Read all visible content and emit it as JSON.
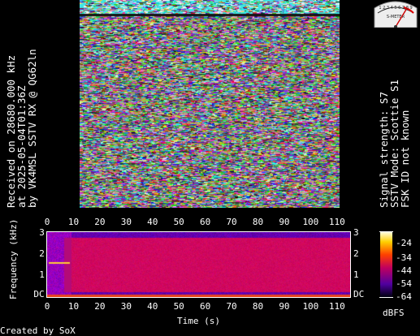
{
  "left_caption": {
    "line1": "Received on  28680.000 kHz",
    "line2": "at 2025-05-04T01:36Z",
    "line3": "by VK4MSL SSTV RX @ QG62ln"
  },
  "right_caption": {
    "line1": "Signal strength: S7",
    "line2": "SSTV Mode: Scottie S1",
    "line3": "FSK ID not known"
  },
  "meter": {
    "scale_text": "1 2 3 4 5 6 7 8 9",
    "units": "S-METER",
    "level": "S7"
  },
  "spectrogram": {
    "y_label": "Frequency (kHz)",
    "x_label": "Time (s)",
    "x_ticks": [
      "0",
      "10",
      "20",
      "30",
      "40",
      "50",
      "60",
      "70",
      "80",
      "90",
      "100",
      "110"
    ],
    "y_ticks_left": [
      "3",
      "2",
      "1",
      "DC"
    ],
    "y_ticks_right": [
      "3",
      "2",
      "1",
      "DC"
    ],
    "colorbar_ticks": [
      "-24",
      "-34",
      "-44",
      "-54",
      "-64"
    ],
    "colorbar_unit": "dBFS"
  },
  "footer": "Created by SoX",
  "colors": {
    "background": "#000000",
    "text": "#ffffff",
    "spectro_band": "#c4005a",
    "spectro_low": "#2a0a60"
  }
}
